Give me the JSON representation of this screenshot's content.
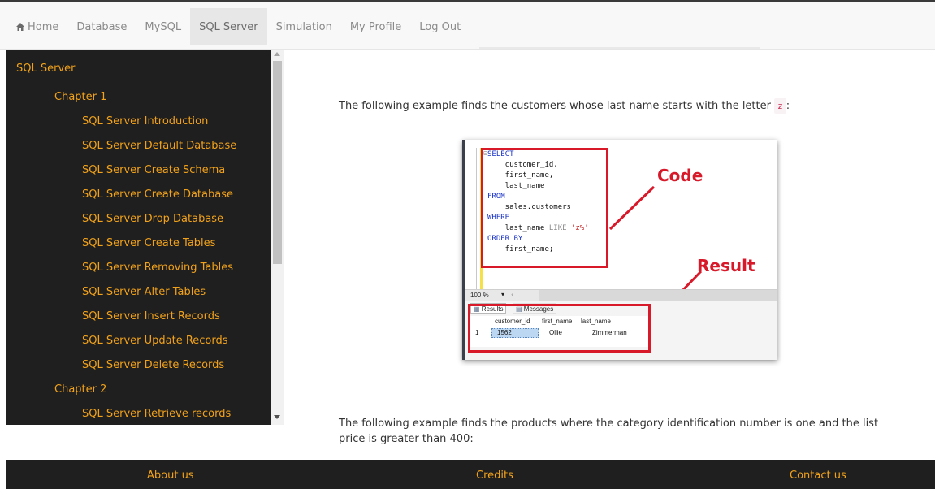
{
  "nav": {
    "items": [
      {
        "label": "Home",
        "icon": "home-icon"
      },
      {
        "label": "Database"
      },
      {
        "label": "MySQL"
      },
      {
        "label": "SQL Server",
        "active": true
      },
      {
        "label": "Simulation"
      },
      {
        "label": "My Profile"
      },
      {
        "label": "Log Out"
      }
    ]
  },
  "sidebar": {
    "title": "SQL Server",
    "chapter1": "Chapter 1",
    "chapter1_items": [
      "SQL Server Introduction",
      "SQL Server Default Database",
      "SQL Server Create Schema",
      "SQL Server Create Database",
      "SQL Server Drop Database",
      "SQL Server Create Tables",
      "SQL Server Removing Tables",
      "SQL Server Alter Tables",
      "SQL Server Insert Records",
      "SQL Server Update Records",
      "SQL Server Delete Records"
    ],
    "chapter2": "Chapter 2",
    "chapter2_items": [
      "SQL Server Retrieve records"
    ]
  },
  "content": {
    "para1_text": "The following example finds the customers whose last name starts with the letter",
    "para1_code": "z",
    "para1_suffix": ":",
    "para2_line1": "The following example finds the products where the category identification number is one and the list",
    "para2_line2": "price is greater than 400:"
  },
  "figure": {
    "code_lines": [
      {
        "kw": "SELECT",
        "rest": ""
      },
      {
        "kw": "",
        "rest": "    customer_id,"
      },
      {
        "kw": "",
        "rest": "    first_name,"
      },
      {
        "kw": "",
        "rest": "    last_name"
      },
      {
        "kw": "FROM",
        "rest": ""
      },
      {
        "kw": "",
        "rest": "    sales.customers"
      },
      {
        "kw": "WHERE",
        "rest": ""
      },
      {
        "kw": "",
        "rest": "    last_name ",
        "op": "LIKE",
        "str": "'z%'"
      },
      {
        "kw": "ORDER BY",
        "rest": ""
      },
      {
        "kw": "",
        "rest": "    first_name;"
      }
    ],
    "code_annotation": "Code",
    "result_annotation": "Result",
    "zoom": "100 %",
    "tabs": [
      "Results",
      "Messages"
    ],
    "columns": [
      "customer_id",
      "first_name",
      "last_name"
    ],
    "rows": [
      {
        "num": "1",
        "customer_id": "1562",
        "first_name": "Ollie",
        "last_name": "Zimmerman"
      }
    ]
  },
  "footer": {
    "about": "About us",
    "credits": "Credits",
    "contact": "Contact us"
  },
  "colors": {
    "accent": "#f2a21a",
    "sidebar_bg": "#1f1f1f",
    "annotation_red": "#d7192a"
  }
}
